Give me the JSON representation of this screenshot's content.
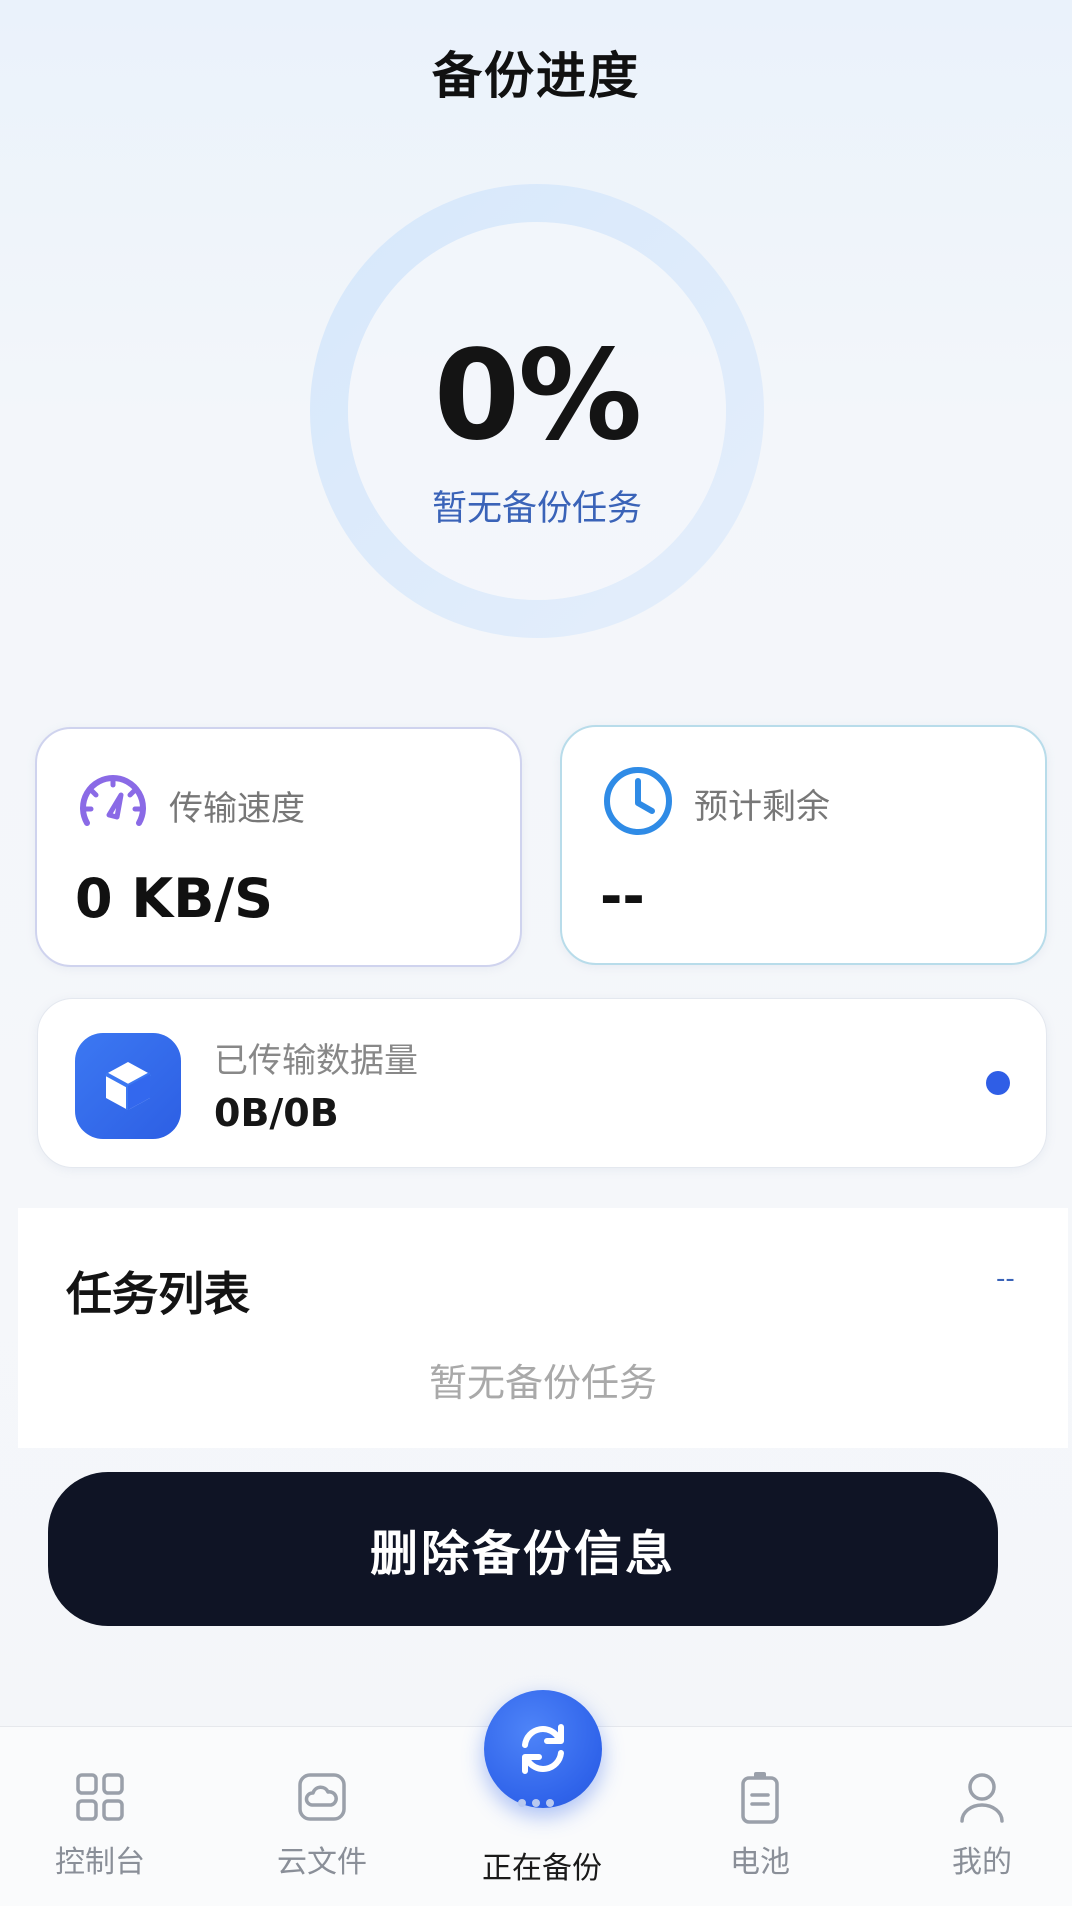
{
  "header": {
    "title": "备份进度"
  },
  "progress": {
    "percent": "0%",
    "fraction": 0,
    "status": "暂无备份任务",
    "ring_color": "#dbeafb"
  },
  "stats": {
    "speed": {
      "icon": "speedometer-icon",
      "label": "传输速度",
      "value": "0 KB/S"
    },
    "eta": {
      "icon": "clock-icon",
      "label": "预计剩余",
      "value": "--"
    },
    "transfer": {
      "icon": "cube-icon",
      "label": "已传输数据量",
      "value": "0B/0B"
    }
  },
  "tasks": {
    "title": "任务列表",
    "more": "--",
    "empty_text": "暂无备份任务"
  },
  "actions": {
    "delete_label": "删除备份信息"
  },
  "nav": {
    "items": [
      {
        "label": "控制台",
        "icon": "grid-icon"
      },
      {
        "label": "云文件",
        "icon": "cloud-folder-icon"
      },
      {
        "label": "正在备份",
        "icon": "sync-icon",
        "active": true
      },
      {
        "label": "电池",
        "icon": "battery-icon"
      },
      {
        "label": "我的",
        "icon": "user-icon"
      }
    ]
  },
  "colors": {
    "accent": "#2f5ee6",
    "button_dark": "#0f1425",
    "speed_icon": "#8a6ae6",
    "clock_icon": "#2f8be6"
  }
}
